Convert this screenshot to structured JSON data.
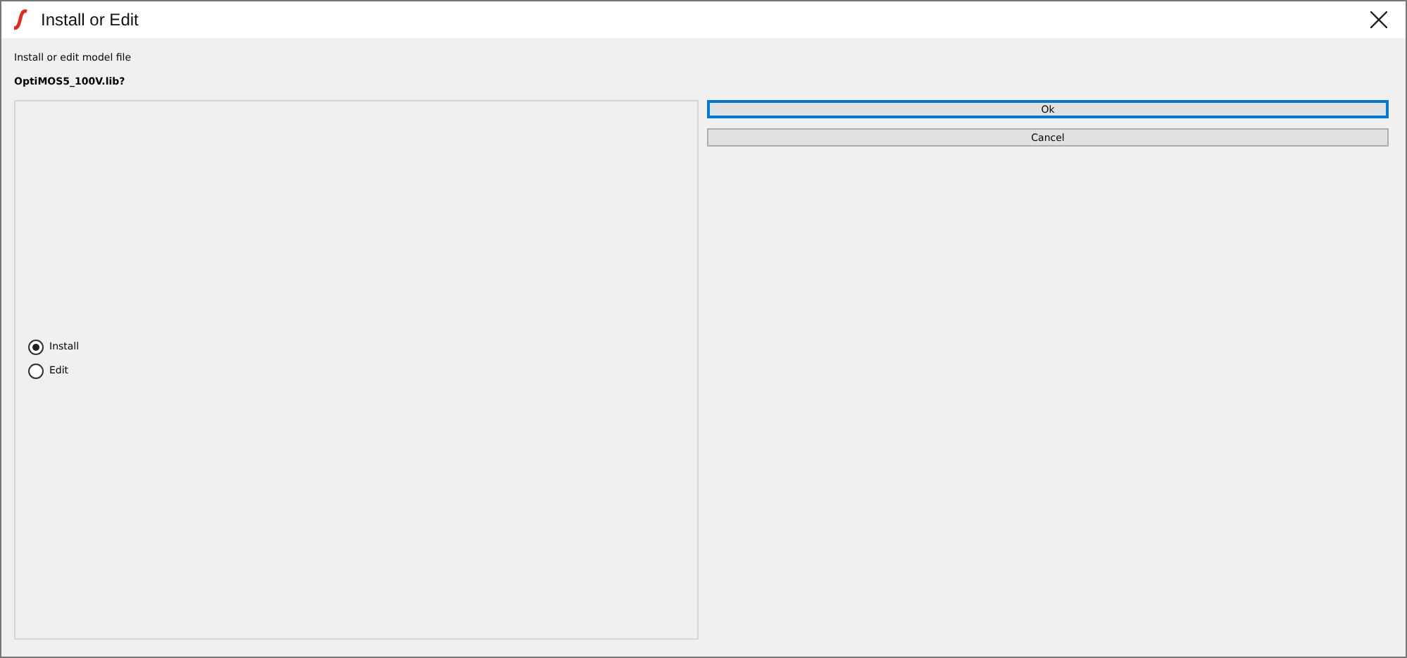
{
  "window": {
    "title": "Install or Edit"
  },
  "prompt": "Install or edit model file",
  "filename": "OptiMOS5_100V.lib?",
  "options": [
    {
      "label": "Install",
      "selected": true
    },
    {
      "label": "Edit",
      "selected": false
    }
  ],
  "buttons": [
    {
      "label": "Ok",
      "focused": true
    },
    {
      "label": "Cancel",
      "focused": false
    }
  ]
}
